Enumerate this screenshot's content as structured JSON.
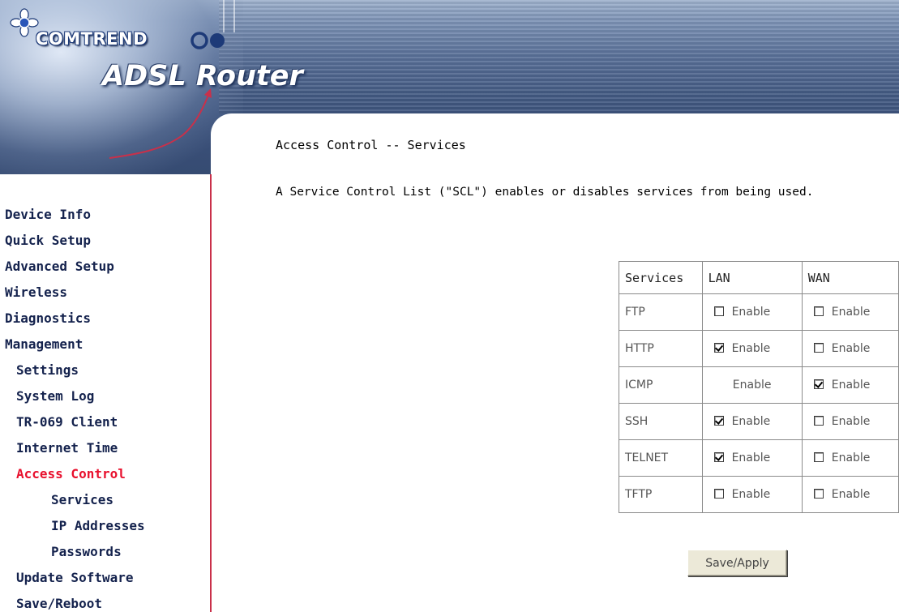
{
  "header": {
    "brand": "COMTREND",
    "product": "ADSL Router"
  },
  "sidebar": {
    "items": [
      {
        "label": "Device Info"
      },
      {
        "label": "Quick Setup"
      },
      {
        "label": "Advanced Setup"
      },
      {
        "label": "Wireless"
      },
      {
        "label": "Diagnostics"
      },
      {
        "label": "Management"
      },
      {
        "label": "Settings"
      },
      {
        "label": "System Log"
      },
      {
        "label": "TR-069 Client"
      },
      {
        "label": "Internet Time"
      },
      {
        "label": "Access Control",
        "active": true
      },
      {
        "label": "Services"
      },
      {
        "label": "IP Addresses"
      },
      {
        "label": "Passwords"
      },
      {
        "label": "Update Software"
      },
      {
        "label": "Save/Reboot"
      }
    ]
  },
  "main": {
    "title": "Access Control -- Services",
    "description": "A Service Control List (\"SCL\") enables or disables services from being used.",
    "table": {
      "headers": [
        "Services",
        "LAN",
        "WAN"
      ],
      "rows": [
        {
          "service": "FTP",
          "lan": {
            "label": "Enable",
            "checkbox": true,
            "checked": false
          },
          "wan": {
            "label": "Enable",
            "checkbox": true,
            "checked": false
          }
        },
        {
          "service": "HTTP",
          "lan": {
            "label": "Enable",
            "checkbox": true,
            "checked": true
          },
          "wan": {
            "label": "Enable",
            "checkbox": true,
            "checked": false
          }
        },
        {
          "service": "ICMP",
          "lan": {
            "label": "Enable",
            "checkbox": false,
            "checked": false
          },
          "wan": {
            "label": "Enable",
            "checkbox": true,
            "checked": true
          }
        },
        {
          "service": "SSH",
          "lan": {
            "label": "Enable",
            "checkbox": true,
            "checked": true
          },
          "wan": {
            "label": "Enable",
            "checkbox": true,
            "checked": false
          }
        },
        {
          "service": "TELNET",
          "lan": {
            "label": "Enable",
            "checkbox": true,
            "checked": true
          },
          "wan": {
            "label": "Enable",
            "checkbox": true,
            "checked": false
          }
        },
        {
          "service": "TFTP",
          "lan": {
            "label": "Enable",
            "checkbox": true,
            "checked": false
          },
          "wan": {
            "label": "Enable",
            "checkbox": true,
            "checked": false
          }
        }
      ]
    },
    "save_label": "Save/Apply"
  },
  "colors": {
    "nav_text": "#14224d",
    "nav_active": "#e8102d",
    "sidebar_border": "#c9304a"
  },
  "icons": [
    "comtrend-logo-icon",
    "checkbox-icon"
  ]
}
